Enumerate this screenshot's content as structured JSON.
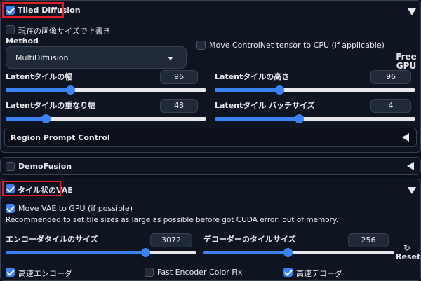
{
  "colors": {
    "background": "#0b0f19",
    "accent": "#3b82f6",
    "highlight": "#e11d2a"
  },
  "tiled_diffusion": {
    "title": "Tiled Diffusion",
    "enabled": true,
    "overwrite_image_size_label": "現在の画像サイズで上書き",
    "overwrite_image_size": false,
    "method_label": "Method",
    "method_value": "MultiDiffusion",
    "move_controlnet_label": "Move ControlNet tensor to CPU (if applicable)",
    "move_controlnet": false,
    "free_gpu_label": "Free\nGPU",
    "latent_tile_width": {
      "label": "Latentタイルの幅",
      "value": "96",
      "fraction": 0.32
    },
    "latent_tile_height": {
      "label": "Latentタイルの高さ",
      "value": "96",
      "fraction": 0.32
    },
    "latent_tile_overlap": {
      "label": "Latentタイルの重なり幅",
      "value": "48",
      "fraction": 0.2
    },
    "latent_tile_batch": {
      "label": "Latentタイル バッチサイズ",
      "value": "4",
      "fraction": 0.42
    },
    "region_prompt_control_label": "Region Prompt Control"
  },
  "demofusion": {
    "title": "DemoFusion",
    "enabled": false
  },
  "tiled_vae": {
    "title": "タイル状のVAE",
    "enabled": true,
    "move_vae_label": "Move VAE to GPU (if possible)",
    "move_vae": true,
    "recommendation": "Recommended to set tile sizes as large as possible before got CUDA error: out of memory.",
    "encoder_tile_size": {
      "label": "エンコーダタイルのサイズ",
      "value": "3072",
      "fraction": 0.73
    },
    "decoder_tile_size": {
      "label": "デコーダーのタイルサイズ",
      "value": "256",
      "fraction": 0.44
    },
    "reset_label": "Reset",
    "fast_encoder_label": "高速エンコーダ",
    "fast_encoder": true,
    "fast_encoder_color_fix_label": "Fast Encoder Color Fix",
    "fast_encoder_color_fix": false,
    "fast_decoder_label": "高速デコーダ",
    "fast_decoder": true
  }
}
